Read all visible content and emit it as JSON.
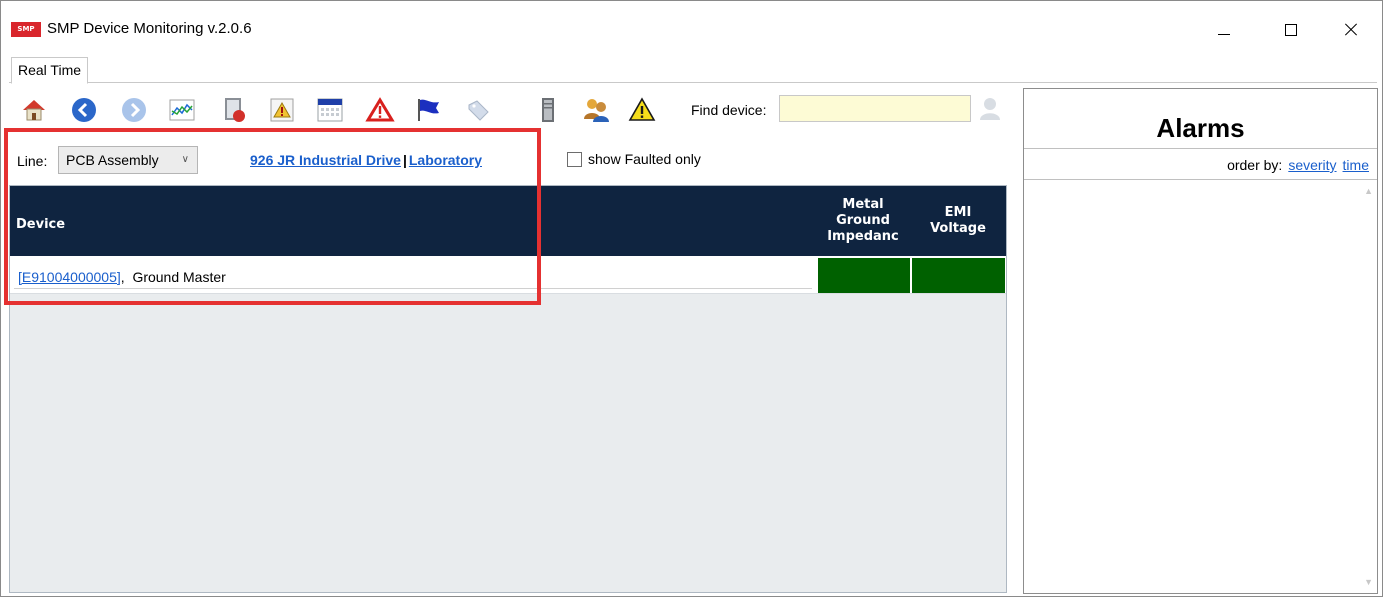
{
  "window": {
    "title": "SMP Device Monitoring v.2.0.6",
    "logo_text": "SMP"
  },
  "tabs": [
    {
      "label": "Real Time"
    }
  ],
  "toolbar": {
    "icons": [
      "home-icon",
      "back-icon",
      "forward-icon",
      "chart-icon",
      "report-icon",
      "warning-report-icon",
      "calendar-icon",
      "alarm-icon",
      "flag-icon",
      "tag-icon",
      "server-icon",
      "users-icon",
      "caution-icon"
    ],
    "find_label": "Find device:",
    "find_value": ""
  },
  "filter": {
    "line_label": "Line:",
    "line_value": "PCB Assembly",
    "location": "926 JR Industrial Drive",
    "separator": "|",
    "area": "Laboratory",
    "faulted_label": "show Faulted only"
  },
  "grid": {
    "columns": {
      "device": "Device",
      "col1_lines": [
        "Metal",
        "Ground",
        "Impedanc"
      ],
      "col2_lines": [
        "EMI",
        "Voltage"
      ]
    },
    "rows": [
      {
        "device_id": "[E91004000005]",
        "separator": ",",
        "device_name": "Ground Master",
        "status_colors": [
          "#006100",
          "#006100"
        ]
      }
    ]
  },
  "alarms": {
    "title": "Alarms",
    "order_by_label": "order by:",
    "order_options": [
      "severity",
      "time"
    ]
  },
  "colors": {
    "header_bg": "#0f2440",
    "status_ok": "#006100",
    "highlight": "#e53131",
    "link": "#1a5fcc",
    "find_bg": "#fdfbd5"
  }
}
